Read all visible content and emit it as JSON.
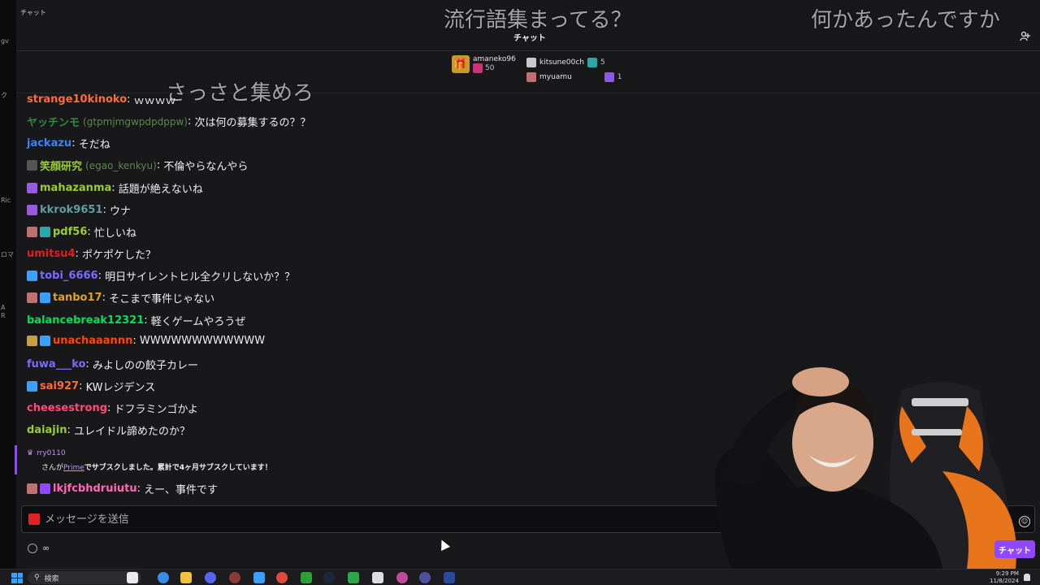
{
  "window": {
    "titlebar_label": "チャット",
    "header_title": "チャット"
  },
  "left_strip_fragments": [
    "gv",
    "ク",
    "Ric",
    "ロマ",
    "A",
    "R"
  ],
  "overlay": {
    "top_center": "流行語集まってる？",
    "top_right": "何かあったんですか",
    "mid": "さっさと集めろ"
  },
  "leaderboard": {
    "first": {
      "name": "amaneko96",
      "count": "50"
    },
    "second": {
      "name": "kitsune00ch",
      "count": "5"
    },
    "third": {
      "name": "myuamu",
      "count": "1"
    }
  },
  "messages": [
    {
      "user": "strange10kinoko",
      "color": "#ff6b3d",
      "text": "ｗｗｗｗ"
    },
    {
      "user": "ヤッチンモ",
      "handle": "(gtpmjmgwpdpdppw)",
      "color": "#2e8b3a",
      "text": "次は何の募集するの？？"
    },
    {
      "user": "jackazu",
      "color": "#3a82f7",
      "text": "そだね"
    },
    {
      "user": "笑顔研究",
      "handle": "(egao_kenkyu)",
      "color": "#9acd32",
      "text": "不倫やらなんやら"
    },
    {
      "user": "mahazanma",
      "color": "#9acd32",
      "text": "話題が絶えないね"
    },
    {
      "user": "kkrok9651",
      "color": "#5f9ea0",
      "text": "ウナ"
    },
    {
      "user": "pdf56",
      "color": "#9acd32",
      "text": "忙しいね"
    },
    {
      "user": "umitsu4",
      "color": "#e02020",
      "text": "ポケポケした？"
    },
    {
      "user": "tobi_6666",
      "color": "#7a6cff",
      "text": "明日サイレントヒル全クリしないか？？"
    },
    {
      "user": "tanbo17",
      "color": "#daa520",
      "text": "そこまで事件じゃない"
    },
    {
      "user": "balancebreak12321",
      "color": "#00e05a",
      "text": "軽くゲームやろうぜ"
    },
    {
      "user": "unachaaannn",
      "color": "#ff4500",
      "text": "WWWWWWWWWWWW"
    },
    {
      "user": "fuwa___ko",
      "color": "#7a6cff",
      "text": "みよしのの餃子カレー"
    },
    {
      "user": "sai927",
      "color": "#ff6b3d",
      "text": "KWレジデンス"
    },
    {
      "user": "cheesestrong",
      "color": "#ff4a7a",
      "text": "ドフラミンゴかよ"
    },
    {
      "user": "daiajin",
      "color": "#9acd32",
      "text": "ユレイドル諦めたのか？"
    }
  ],
  "sub_notice": {
    "user": "rry0110",
    "text_before": "さんが",
    "prime": "Prime",
    "text_after": "でサブスクしました。累計で4ヶ月サブスクしています！"
  },
  "last_message": {
    "user": "lkjfcbhdruiutu",
    "color": "#ff69b4",
    "text": "えー、事件です"
  },
  "input": {
    "placeholder": "メッセージを送信"
  },
  "points": {
    "value": "∞"
  },
  "chat_button": "チャット",
  "taskbar": {
    "search_label": "検索",
    "time": "9:29 PM",
    "date": "11/8/2024"
  },
  "colors": {
    "accent": "#9147ff",
    "background": "#18181b",
    "text": "#efeff1"
  }
}
